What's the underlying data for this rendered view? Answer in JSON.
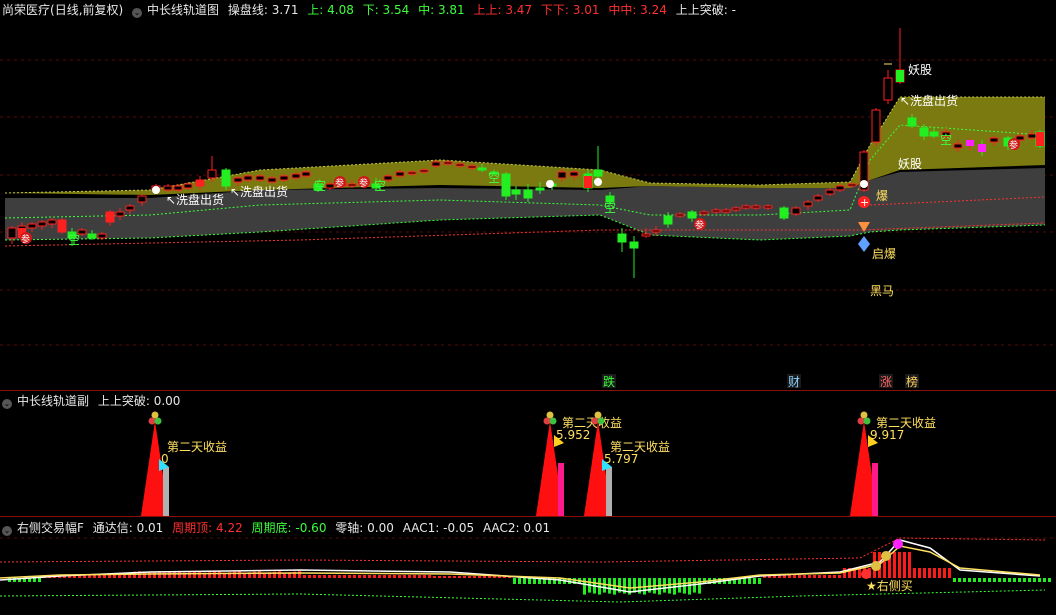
{
  "main": {
    "stock_name": "尚荣医疗",
    "period": "(日线,前复权)",
    "indicator_name": "中长线轨道图",
    "values": [
      {
        "label": "操盘线: 3.71",
        "color": "w"
      },
      {
        "label": "上: 4.08",
        "color": "g"
      },
      {
        "label": "下: 3.54",
        "color": "g"
      },
      {
        "label": "中: 3.81",
        "color": "g"
      },
      {
        "label": "上上: 3.47",
        "color": "r"
      },
      {
        "label": "下下: 3.01",
        "color": "r"
      },
      {
        "label": "中中: 3.24",
        "color": "r"
      },
      {
        "label": "上上突破: -",
        "color": "w"
      }
    ],
    "annotations": {
      "washout1": "↖洗盘出货",
      "washout2": "↖洗盘出货",
      "washout3": "↖洗盘出货",
      "monster1": "妖股",
      "monster2": "妖股",
      "boom": "爆",
      "qibao": "启爆",
      "heima": "黑马",
      "kong": "空",
      "can": "参"
    },
    "bottom_tags": [
      {
        "text": "跌",
        "color": "#3cff3c"
      },
      {
        "text": "财",
        "color": "#8ad0ff"
      },
      {
        "text": "涨",
        "color": "#ff6060"
      },
      {
        "text": "榜",
        "color": "#ffd060"
      }
    ]
  },
  "sub": {
    "indicator_name": "中长线轨道副",
    "break_label": "上上突破: 0.00",
    "profit_label": "第二天收益",
    "profit_values": [
      "0",
      "5.952",
      "5.797",
      "9.917"
    ]
  },
  "osc": {
    "indicator_name": "右侧交易幅F",
    "values": [
      {
        "label": "通达信: 0.01",
        "color": "w"
      },
      {
        "label": "周期顶: 4.22",
        "color": "r"
      },
      {
        "label": "周期底: -0.60",
        "color": "g"
      },
      {
        "label": "零轴: 0.00",
        "color": "w"
      },
      {
        "label": "AAC1: -0.05",
        "color": "w"
      },
      {
        "label": "AAC2: 0.01",
        "color": "w"
      }
    ],
    "buy_label": "★右侧买"
  },
  "colors": {
    "up": "#ff2020",
    "down": "#22ee22",
    "band_upper": "#7a7a10",
    "band_lower": "#3e3e3e",
    "grid": "#5a0a0a",
    "magenta": "#ff22ff"
  }
}
